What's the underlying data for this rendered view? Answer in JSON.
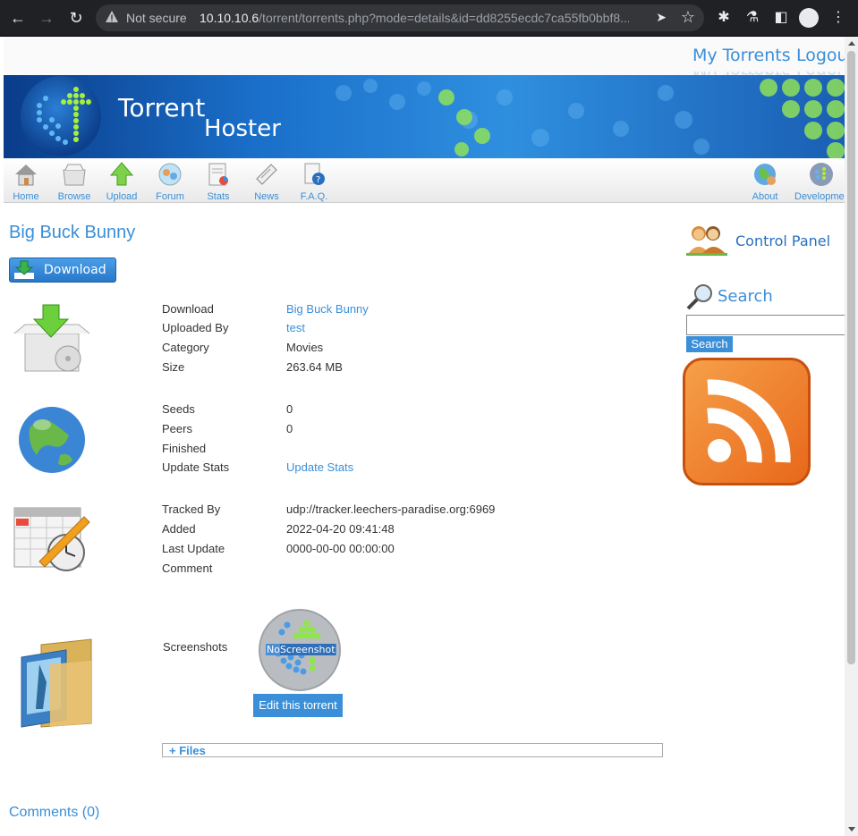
{
  "browser": {
    "security_label": "Not secure",
    "url_host": "10.10.10.6",
    "url_path": "/torrent/torrents.php?mode=details&id=dd8255ecdc7ca55fb0bbf8..."
  },
  "header": {
    "links": [
      "My Torrents",
      "Logout"
    ]
  },
  "banner": {
    "title_line1": "Torrent",
    "title_line2": "Hoster"
  },
  "toolbar": {
    "items": [
      "Home",
      "Browse",
      "Upload",
      "Forum",
      "Stats",
      "News",
      "F.A.Q."
    ],
    "right_items": [
      "About",
      "Development"
    ]
  },
  "torrent": {
    "title": "Big Buck Bunny",
    "download_button": "Download",
    "details": [
      {
        "label": "Download",
        "value": "Big Buck Bunny",
        "link": true
      },
      {
        "label": "Uploaded By",
        "value": "test",
        "link": true
      },
      {
        "label": "Category",
        "value": "Movies",
        "link": false
      },
      {
        "label": "Size",
        "value": "263.64 MB",
        "link": false
      }
    ],
    "stats": [
      {
        "label": "Seeds",
        "value": "0",
        "link": false
      },
      {
        "label": "Peers",
        "value": "0",
        "link": false
      },
      {
        "label": "Finished",
        "value": "",
        "link": false
      },
      {
        "label": "Update Stats",
        "value": "Update Stats",
        "link": true
      }
    ],
    "tracking": [
      {
        "label": "Tracked By",
        "value": "udp://tracker.leechers-paradise.org:6969",
        "link": false
      },
      {
        "label": "Added",
        "value": "2022-04-20 09:41:48",
        "link": false
      },
      {
        "label": "Last Update",
        "value": "0000-00-00 00:00:00",
        "link": false
      },
      {
        "label": "Comment",
        "value": "",
        "link": false
      }
    ],
    "screenshots_label": "Screenshots",
    "no_screenshot_no": "No",
    "no_screenshot_rest": "Screenshot",
    "edit_button": "Edit this torrent",
    "files_toggle": "+ Files",
    "comments_link": "Comments (0)"
  },
  "sidebar": {
    "control_panel": "Control Panel",
    "search_title": "Search",
    "search_value": "",
    "search_button": "Search"
  },
  "colors": {
    "link": "#3a8fd8",
    "banner": "#1a6fc9"
  }
}
